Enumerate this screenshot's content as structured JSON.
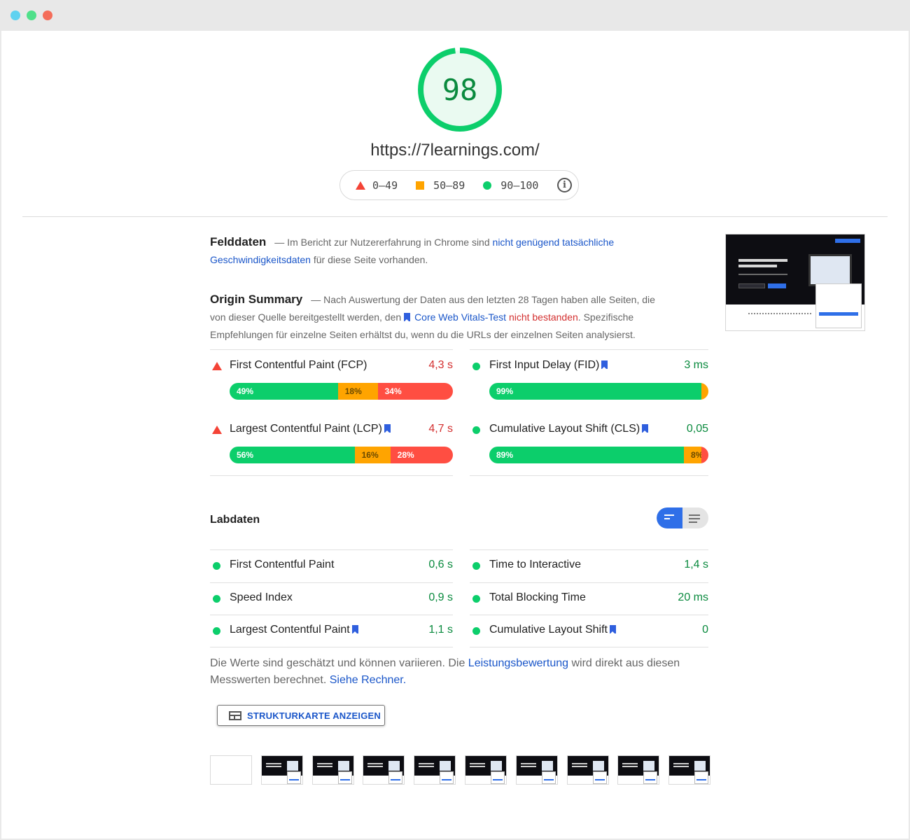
{
  "score": {
    "value": "98",
    "fraction": 0.98,
    "color": "#0cce6b"
  },
  "url": "https://7learnings.com/",
  "legend": {
    "fail": "0–49",
    "average": "50–89",
    "pass": "90–100",
    "info_icon": "info-icon"
  },
  "field_data": {
    "heading": "Felddaten",
    "text_before": "— Im Bericht zur Nutzererfahrung in Chrome sind ",
    "link": "nicht genügend tatsächliche Geschwindigkeitsdaten",
    "text_after": " für diese Seite vorhanden."
  },
  "origin_summary": {
    "heading": "Origin Summary",
    "text_before": "— Nach Auswertung der Daten aus den letzten 28 Tagen haben alle Seiten, die von dieser Quelle bereitgestellt werden, den ",
    "link": "Core Web Vitals-Test",
    "fail_text": "nicht bestanden",
    "text_after": ". Spezifische Empfehlungen für einzelne Seiten erhältst du, wenn du die URLs der einzelnen Seiten analysierst."
  },
  "origin_metrics": {
    "left": [
      {
        "name": "First Contentful Paint (FCP)",
        "value": "4,3 s",
        "status": "fail",
        "bookmark": false,
        "dist": [
          "49%",
          "18%",
          "34%"
        ],
        "dist_values": [
          49,
          18,
          34
        ]
      },
      {
        "name": "Largest Contentful Paint (LCP)",
        "value": "4,7 s",
        "status": "fail",
        "bookmark": true,
        "dist": [
          "56%",
          "16%",
          "28%"
        ],
        "dist_values": [
          56,
          16,
          28
        ]
      }
    ],
    "right": [
      {
        "name": "First Input Delay (FID)",
        "value": "3 ms",
        "status": "pass",
        "bookmark": true,
        "dist": [
          "99%",
          "1%",
          ""
        ],
        "dist_values": [
          99,
          1,
          0
        ]
      },
      {
        "name": "Cumulative Layout Shift (CLS)",
        "value": "0,05",
        "status": "pass",
        "bookmark": true,
        "dist": [
          "89%",
          "8%",
          "3%"
        ],
        "dist_values": [
          89,
          8,
          3
        ]
      }
    ]
  },
  "lab_data": {
    "heading": "Labdaten",
    "left": [
      {
        "name": "First Contentful Paint",
        "value": "0,6 s",
        "bookmark": false
      },
      {
        "name": "Speed Index",
        "value": "0,9 s",
        "bookmark": false
      },
      {
        "name": "Largest Contentful Paint",
        "value": "1,1 s",
        "bookmark": true
      }
    ],
    "right": [
      {
        "name": "Time to Interactive",
        "value": "1,4 s",
        "bookmark": false
      },
      {
        "name": "Total Blocking Time",
        "value": "20 ms",
        "bookmark": false
      },
      {
        "name": "Cumulative Layout Shift",
        "value": "0",
        "bookmark": true
      }
    ]
  },
  "note": {
    "text_before": "Die Werte sind geschätzt und können variieren. Die ",
    "link1": "Leistungsbewertung",
    "text_middle": " wird direkt aus diesen Messwerten berechnet. ",
    "link2": "Siehe Rechner."
  },
  "treemap_button": "STRUKTURKARTE ANZEIGEN",
  "filmstrip_frames": 10,
  "colors": {
    "pass": "#0cce6b",
    "average": "#ffa400",
    "fail": "#ff4e42",
    "link": "#1a56c9"
  }
}
